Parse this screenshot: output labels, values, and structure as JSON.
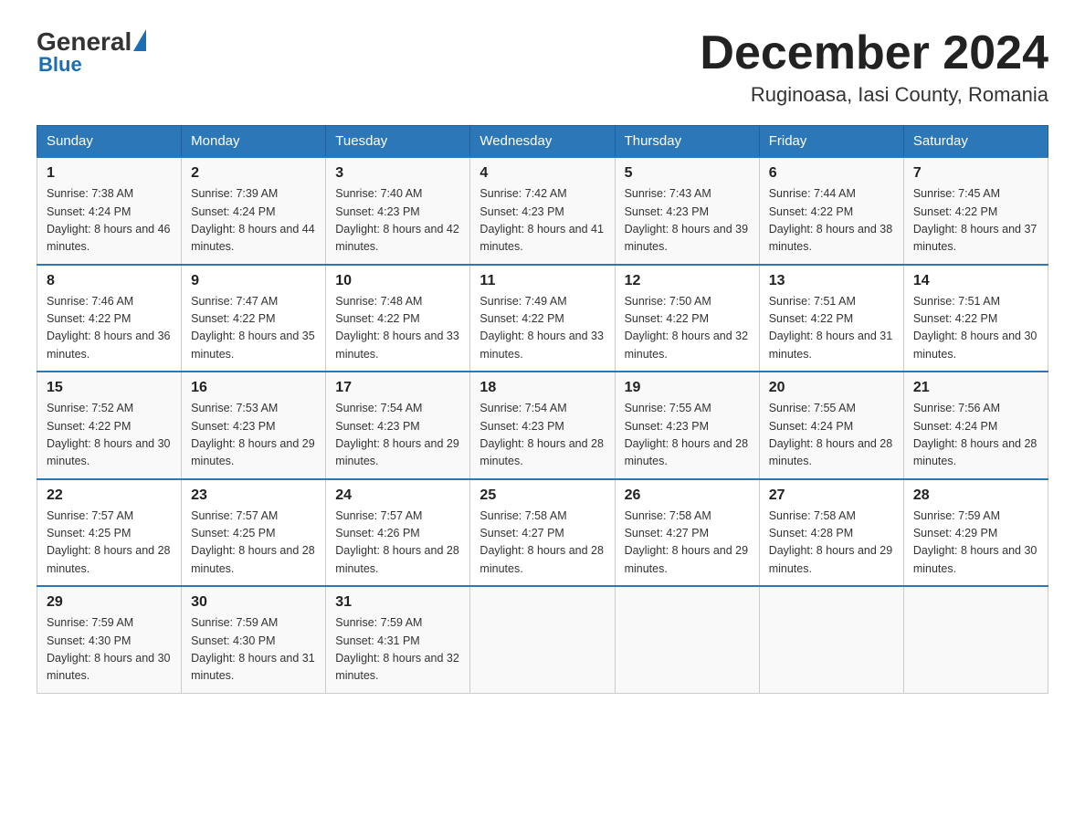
{
  "logo": {
    "general": "General",
    "triangle": "",
    "blue": "Blue"
  },
  "header": {
    "title": "December 2024",
    "subtitle": "Ruginoasa, Iasi County, Romania"
  },
  "weekdays": [
    "Sunday",
    "Monday",
    "Tuesday",
    "Wednesday",
    "Thursday",
    "Friday",
    "Saturday"
  ],
  "weeks": [
    [
      {
        "day": "1",
        "sunrise": "7:38 AM",
        "sunset": "4:24 PM",
        "daylight": "8 hours and 46 minutes."
      },
      {
        "day": "2",
        "sunrise": "7:39 AM",
        "sunset": "4:24 PM",
        "daylight": "8 hours and 44 minutes."
      },
      {
        "day": "3",
        "sunrise": "7:40 AM",
        "sunset": "4:23 PM",
        "daylight": "8 hours and 42 minutes."
      },
      {
        "day": "4",
        "sunrise": "7:42 AM",
        "sunset": "4:23 PM",
        "daylight": "8 hours and 41 minutes."
      },
      {
        "day": "5",
        "sunrise": "7:43 AM",
        "sunset": "4:23 PM",
        "daylight": "8 hours and 39 minutes."
      },
      {
        "day": "6",
        "sunrise": "7:44 AM",
        "sunset": "4:22 PM",
        "daylight": "8 hours and 38 minutes."
      },
      {
        "day": "7",
        "sunrise": "7:45 AM",
        "sunset": "4:22 PM",
        "daylight": "8 hours and 37 minutes."
      }
    ],
    [
      {
        "day": "8",
        "sunrise": "7:46 AM",
        "sunset": "4:22 PM",
        "daylight": "8 hours and 36 minutes."
      },
      {
        "day": "9",
        "sunrise": "7:47 AM",
        "sunset": "4:22 PM",
        "daylight": "8 hours and 35 minutes."
      },
      {
        "day": "10",
        "sunrise": "7:48 AM",
        "sunset": "4:22 PM",
        "daylight": "8 hours and 33 minutes."
      },
      {
        "day": "11",
        "sunrise": "7:49 AM",
        "sunset": "4:22 PM",
        "daylight": "8 hours and 33 minutes."
      },
      {
        "day": "12",
        "sunrise": "7:50 AM",
        "sunset": "4:22 PM",
        "daylight": "8 hours and 32 minutes."
      },
      {
        "day": "13",
        "sunrise": "7:51 AM",
        "sunset": "4:22 PM",
        "daylight": "8 hours and 31 minutes."
      },
      {
        "day": "14",
        "sunrise": "7:51 AM",
        "sunset": "4:22 PM",
        "daylight": "8 hours and 30 minutes."
      }
    ],
    [
      {
        "day": "15",
        "sunrise": "7:52 AM",
        "sunset": "4:22 PM",
        "daylight": "8 hours and 30 minutes."
      },
      {
        "day": "16",
        "sunrise": "7:53 AM",
        "sunset": "4:23 PM",
        "daylight": "8 hours and 29 minutes."
      },
      {
        "day": "17",
        "sunrise": "7:54 AM",
        "sunset": "4:23 PM",
        "daylight": "8 hours and 29 minutes."
      },
      {
        "day": "18",
        "sunrise": "7:54 AM",
        "sunset": "4:23 PM",
        "daylight": "8 hours and 28 minutes."
      },
      {
        "day": "19",
        "sunrise": "7:55 AM",
        "sunset": "4:23 PM",
        "daylight": "8 hours and 28 minutes."
      },
      {
        "day": "20",
        "sunrise": "7:55 AM",
        "sunset": "4:24 PM",
        "daylight": "8 hours and 28 minutes."
      },
      {
        "day": "21",
        "sunrise": "7:56 AM",
        "sunset": "4:24 PM",
        "daylight": "8 hours and 28 minutes."
      }
    ],
    [
      {
        "day": "22",
        "sunrise": "7:57 AM",
        "sunset": "4:25 PM",
        "daylight": "8 hours and 28 minutes."
      },
      {
        "day": "23",
        "sunrise": "7:57 AM",
        "sunset": "4:25 PM",
        "daylight": "8 hours and 28 minutes."
      },
      {
        "day": "24",
        "sunrise": "7:57 AM",
        "sunset": "4:26 PM",
        "daylight": "8 hours and 28 minutes."
      },
      {
        "day": "25",
        "sunrise": "7:58 AM",
        "sunset": "4:27 PM",
        "daylight": "8 hours and 28 minutes."
      },
      {
        "day": "26",
        "sunrise": "7:58 AM",
        "sunset": "4:27 PM",
        "daylight": "8 hours and 29 minutes."
      },
      {
        "day": "27",
        "sunrise": "7:58 AM",
        "sunset": "4:28 PM",
        "daylight": "8 hours and 29 minutes."
      },
      {
        "day": "28",
        "sunrise": "7:59 AM",
        "sunset": "4:29 PM",
        "daylight": "8 hours and 30 minutes."
      }
    ],
    [
      {
        "day": "29",
        "sunrise": "7:59 AM",
        "sunset": "4:30 PM",
        "daylight": "8 hours and 30 minutes."
      },
      {
        "day": "30",
        "sunrise": "7:59 AM",
        "sunset": "4:30 PM",
        "daylight": "8 hours and 31 minutes."
      },
      {
        "day": "31",
        "sunrise": "7:59 AM",
        "sunset": "4:31 PM",
        "daylight": "8 hours and 32 minutes."
      },
      null,
      null,
      null,
      null
    ]
  ]
}
